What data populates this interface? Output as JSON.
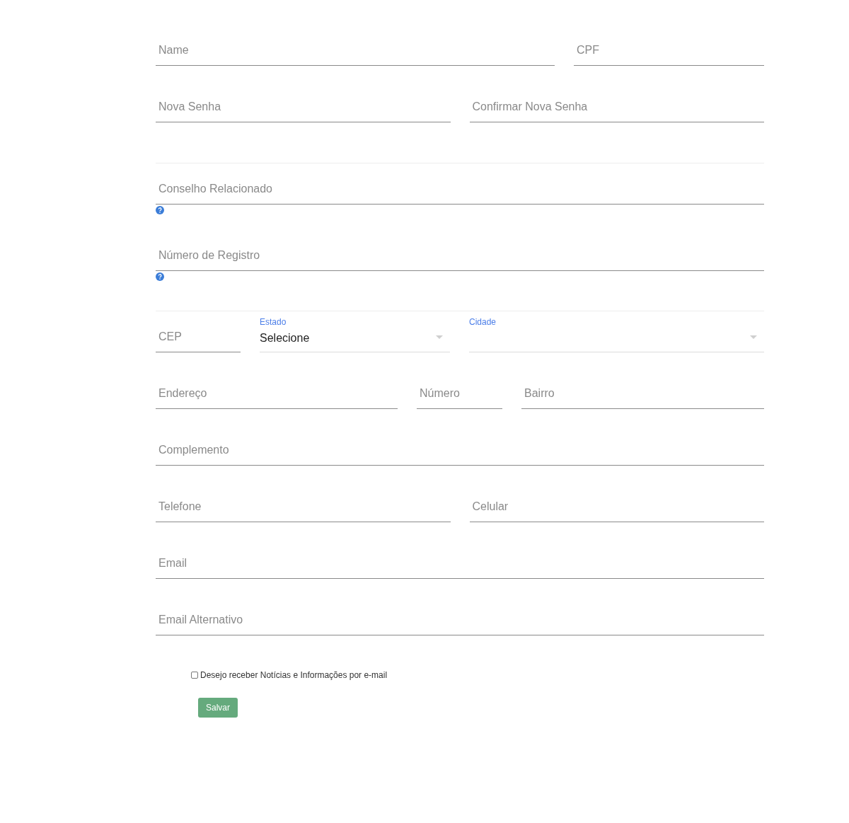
{
  "sections": [
    {
      "rows": [
        [
          {
            "kind": "input",
            "placeholder": "Name"
          },
          {
            "kind": "input",
            "placeholder": "CPF"
          }
        ],
        [
          {
            "kind": "input",
            "placeholder": "Nova Senha"
          },
          {
            "kind": "input",
            "placeholder": "Confirmar Nova Senha"
          }
        ]
      ]
    },
    {
      "rows": [
        [
          {
            "kind": "input",
            "placeholder": "Conselho Relacionado",
            "help": true
          }
        ],
        [
          {
            "kind": "input",
            "placeholder": "Número de Registro",
            "help": true
          }
        ]
      ]
    },
    {
      "rows": [
        [
          {
            "kind": "input",
            "placeholder": "CEP"
          },
          {
            "kind": "select",
            "label": "Estado",
            "value": "Selecione"
          },
          {
            "kind": "select",
            "label": "Cidade"
          }
        ],
        [
          {
            "kind": "input",
            "placeholder": "Endereço"
          },
          {
            "kind": "input",
            "placeholder": "Número"
          },
          {
            "kind": "input",
            "placeholder": "Bairro"
          }
        ],
        [
          {
            "kind": "input",
            "placeholder": "Complemento"
          }
        ],
        [
          {
            "kind": "input",
            "placeholder": "Telefone"
          },
          {
            "kind": "input",
            "placeholder": "Celular"
          }
        ],
        [
          {
            "kind": "input",
            "placeholder": "Email"
          }
        ],
        [
          {
            "kind": "input",
            "placeholder": "Email Alternativo"
          }
        ]
      ]
    }
  ],
  "newsletter": {
    "label": "Desejo receber Notícias e Informações por e-mail",
    "checked": false
  },
  "save_button": "Salvar"
}
